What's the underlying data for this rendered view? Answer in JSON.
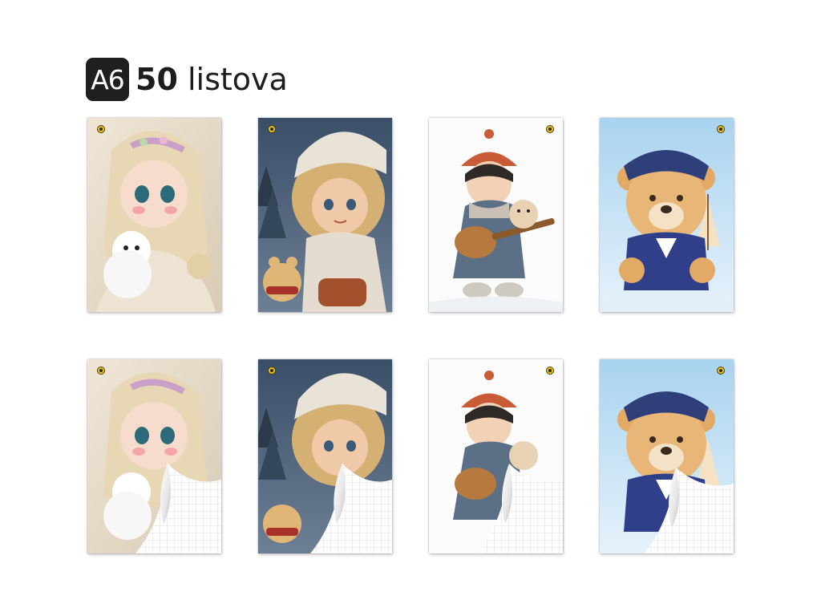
{
  "header": {
    "badge": "A6",
    "count": "50",
    "unit": "listova"
  },
  "products": [
    {
      "design": "princess-with-white-bear",
      "variant": "cover"
    },
    {
      "design": "curly-girl-with-teddy",
      "variant": "cover"
    },
    {
      "design": "boy-with-guitar-and-teddy",
      "variant": "cover"
    },
    {
      "design": "sailor-teddy-bear",
      "variant": "cover"
    },
    {
      "design": "princess-with-white-bear",
      "variant": "cover-peeled-grid-paper"
    },
    {
      "design": "curly-girl-with-teddy",
      "variant": "cover-peeled-grid-paper"
    },
    {
      "design": "boy-with-guitar-and-teddy",
      "variant": "cover-peeled-grid-paper"
    },
    {
      "design": "sailor-teddy-bear",
      "variant": "cover-peeled-grid-paper"
    }
  ],
  "colors": {
    "badge_bg": "#1f1f1f",
    "ring": "#e9c21d",
    "paper_grid": "#d9d9d9"
  }
}
